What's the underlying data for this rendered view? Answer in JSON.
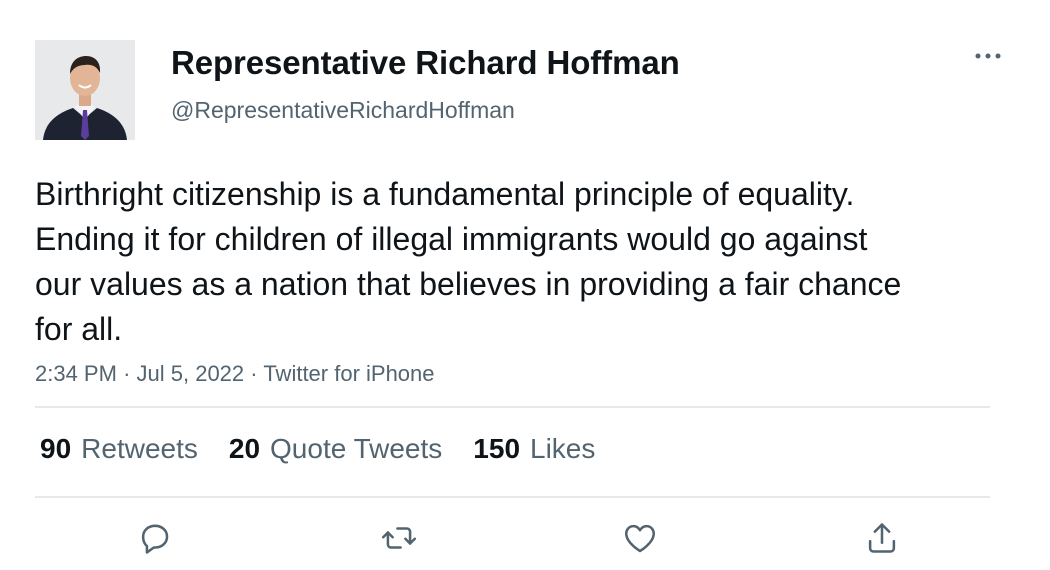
{
  "author": {
    "display_name": "Representative Richard Hoffman",
    "handle": "@RepresentativeRichardHoffman",
    "avatar_alt": "profile-photo"
  },
  "tweet": {
    "text": "Birthright citizenship is a fundamental principle of equality. Ending it for children of illegal immigrants would go against our values as a nation that believes in providing a fair chance for all.",
    "time": "2:34 PM",
    "date": "Jul 5, 2022",
    "source": "Twitter for iPhone",
    "separator": "·"
  },
  "stats": {
    "retweets": {
      "count": "90",
      "label": "Retweets"
    },
    "quote_tweets": {
      "count": "20",
      "label": "Quote Tweets"
    },
    "likes": {
      "count": "150",
      "label": "Likes"
    }
  },
  "actions": [
    {
      "name": "reply",
      "icon": "reply-icon"
    },
    {
      "name": "retweet",
      "icon": "retweet-icon"
    },
    {
      "name": "like",
      "icon": "heart-icon"
    },
    {
      "name": "share",
      "icon": "share-icon"
    }
  ],
  "colors": {
    "text_primary": "#0f1419",
    "text_secondary": "#536471",
    "icon": "#536471",
    "divider": "#e6e9ec",
    "background": "#ffffff"
  }
}
